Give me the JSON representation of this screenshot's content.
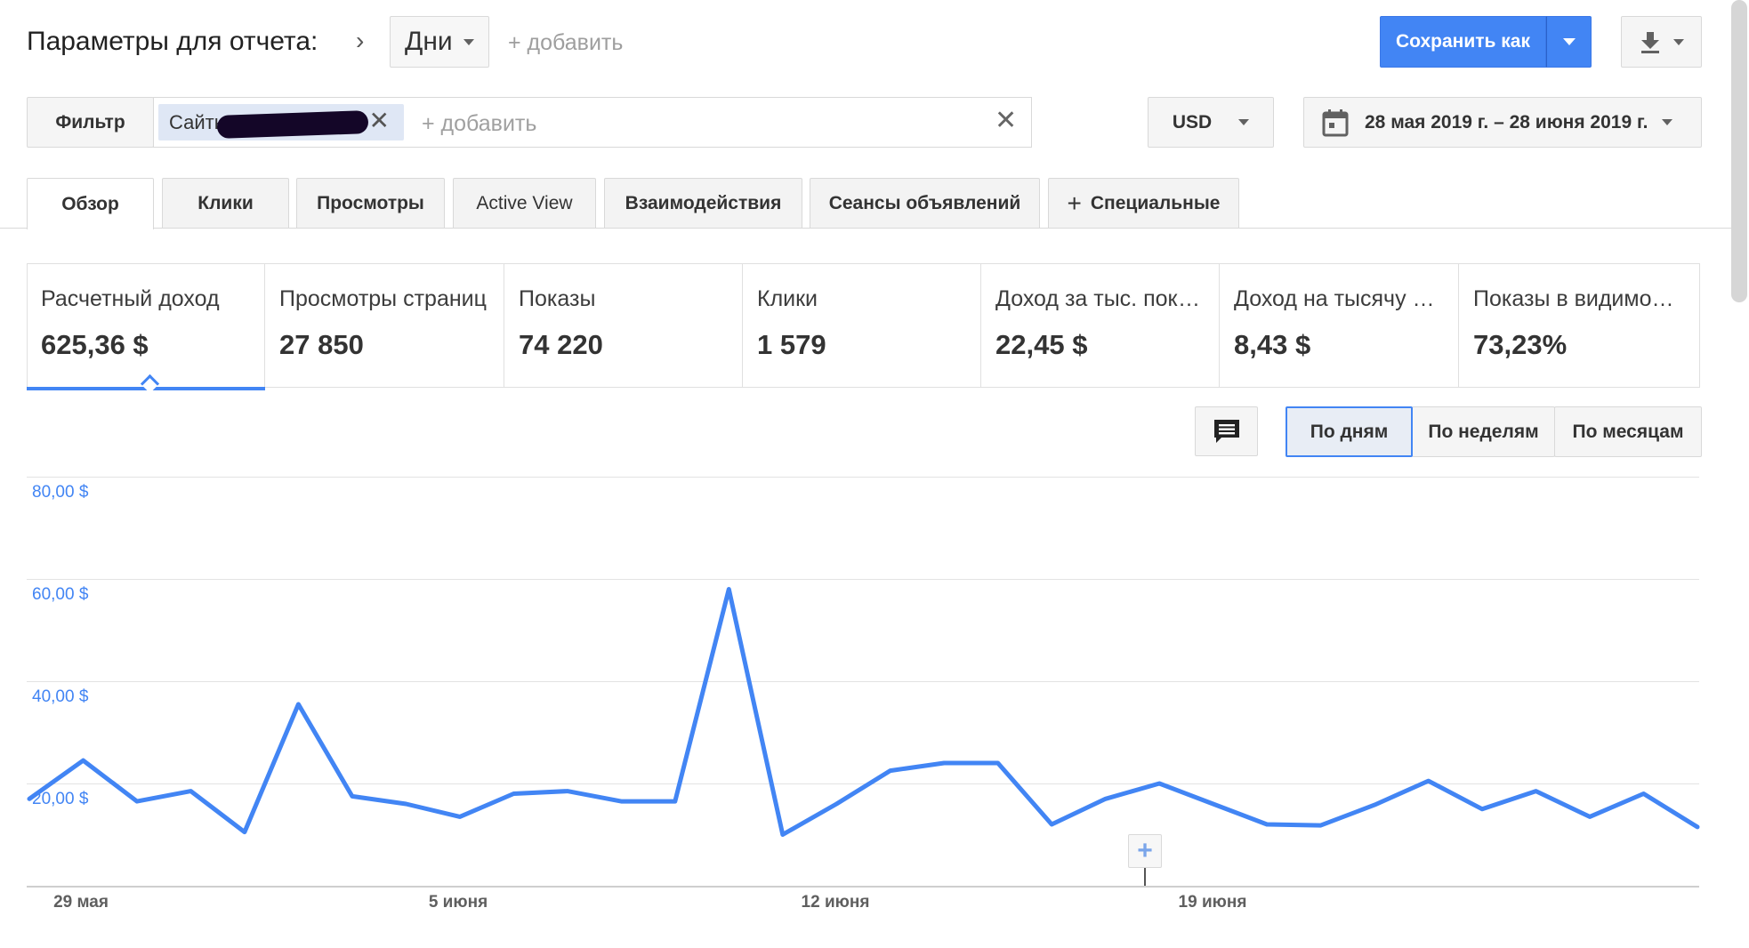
{
  "header": {
    "title": "Параметры для отчета:",
    "dimension_value": "Дни",
    "add_link": "+ добавить",
    "save_as": "Сохранить как"
  },
  "filter": {
    "label": "Фильтр",
    "chip_text": "Сайты",
    "add_text": "+ добавить"
  },
  "currency": "USD",
  "date_range": "28 мая 2019 г. – 28 июня 2019 г.",
  "tabs": [
    {
      "label": "Обзор"
    },
    {
      "label": "Клики"
    },
    {
      "label": "Просмотры"
    },
    {
      "label": "Active View"
    },
    {
      "label": "Взаимодействия"
    },
    {
      "label": "Сеансы объявлений"
    },
    {
      "label": "Специальные"
    }
  ],
  "metrics": [
    {
      "label": "Расчетный доход",
      "value": "625,36 $"
    },
    {
      "label": "Просмотры страниц",
      "value": "27 850"
    },
    {
      "label": "Показы",
      "value": "74 220"
    },
    {
      "label": "Клики",
      "value": "1 579"
    },
    {
      "label": "Доход за тыс. показов",
      "value": "22,45 $"
    },
    {
      "label": "Доход на тысячу запросов",
      "value": "8,43 $"
    },
    {
      "label": "Показы в видимой области",
      "value": "73,23%"
    }
  ],
  "period": {
    "day": "По дням",
    "week": "По неделям",
    "month": "По месяцам"
  },
  "colors": {
    "accent": "#4285f4",
    "line": "#4285f4"
  },
  "icons": {
    "comment": "comment-icon",
    "calendar": "calendar-icon",
    "download": "download-icon",
    "close": "close-icon",
    "add_annotation": "plus-icon"
  },
  "chart_data": {
    "type": "line",
    "y_ticks": [
      "80,00 $",
      "60,00 $",
      "40,00 $",
      "20,00 $"
    ],
    "x_ticks": [
      "29 мая",
      "5 июня",
      "12 июня",
      "19 июня"
    ],
    "ylim": [
      0,
      80
    ],
    "grid": true,
    "series": [
      {
        "values": [
          17,
          24.5,
          16.5,
          18.5,
          10.5,
          35.5,
          17.5,
          16,
          13.5,
          18,
          18.5,
          16.5,
          16.5,
          58,
          10,
          16,
          22.5,
          24,
          24,
          12,
          17,
          20,
          16,
          12,
          11.8,
          15.8,
          20.5,
          15,
          18.5,
          13.5,
          18,
          11.5
        ]
      }
    ]
  }
}
